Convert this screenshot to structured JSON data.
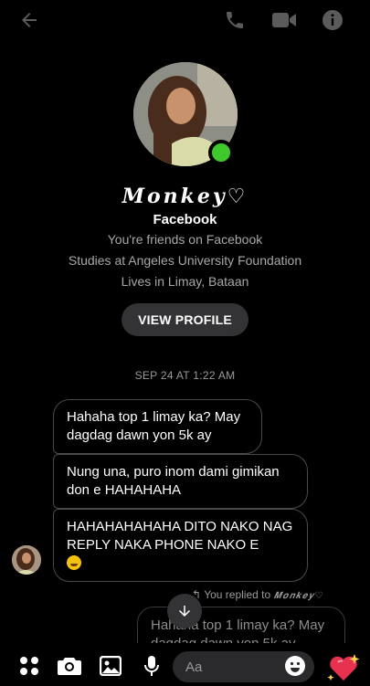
{
  "contact": {
    "name": "𝑴𝒐𝒏𝒌𝒆𝒚♡",
    "platform": "Facebook",
    "friends_text": "You're friends on Facebook",
    "studies_text": "Studies at Angeles University Foundation",
    "lives_text": "Lives in Limay, Bataan",
    "view_profile_label": "VIEW PROFILE",
    "online": true
  },
  "conversation": {
    "timestamp": "SEP 24 AT 1:22 AM",
    "messages": [
      {
        "text": "Hahaha top 1 limay ka? May dagdag dawn yon 5k ay"
      },
      {
        "text": "Nung una, puro inom dami gimikan don e HAHAHAHA"
      },
      {
        "text": "HAHAHAHAHAHA DITO NAKO NAG REPLY NAKA PHONE NAKO E",
        "emoji": "rolling-on-floor-laughing"
      }
    ],
    "reply": {
      "label": "You replied to",
      "name": "𝑴𝒐𝒏𝒌𝒆𝒚♡",
      "quoted_text": "Hahaha top 1 limay ka? May dagdag dawn yon 5k ay"
    }
  },
  "composer": {
    "placeholder": "Aa"
  },
  "icons": {
    "back": "arrow-left-icon",
    "call": "phone-icon",
    "video": "video-camera-icon",
    "info": "info-icon",
    "scroll": "arrow-down-icon",
    "apps": "four-dots-icon",
    "camera": "camera-icon",
    "gallery": "image-icon",
    "mic": "microphone-icon",
    "emoji": "smiley-icon",
    "heart": "sparkling-heart-icon"
  },
  "colors": {
    "background": "#000000",
    "online": "#3ec82c",
    "icon_gray": "#5b5b5b",
    "heart": "#e8304f"
  }
}
